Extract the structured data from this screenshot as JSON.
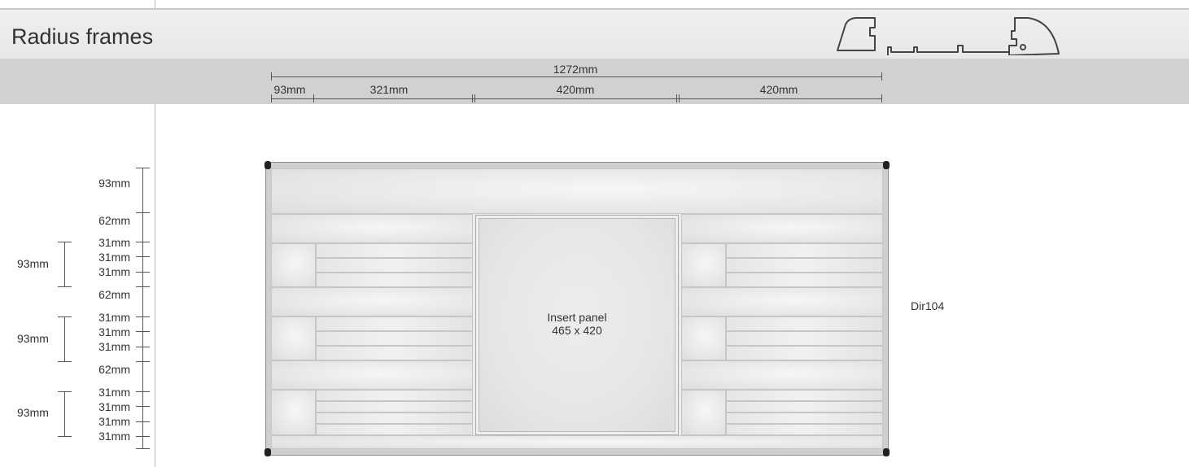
{
  "title": "Radius frames",
  "product_code": "Dir104",
  "colors": {
    "band_light": "#ececec",
    "band_dark": "#d1d1d1",
    "frame": "#cfcfcf",
    "text": "#333333"
  },
  "icon": "radius-frame-profile-icon",
  "horizontal_dimensions": {
    "overall": "1272mm",
    "segments": [
      "93mm",
      "321mm",
      "420mm",
      "420mm"
    ]
  },
  "vertical_dimensions": {
    "inner": [
      "93mm",
      "62mm",
      "31mm",
      "31mm",
      "31mm",
      "62mm",
      "31mm",
      "31mm",
      "31mm",
      "62mm",
      "31mm",
      "31mm",
      "31mm",
      "31mm"
    ],
    "group_totals": [
      "93mm",
      "93mm",
      "93mm"
    ]
  },
  "insert_panel": {
    "line1": "Insert panel",
    "line2": "465 x 420"
  }
}
